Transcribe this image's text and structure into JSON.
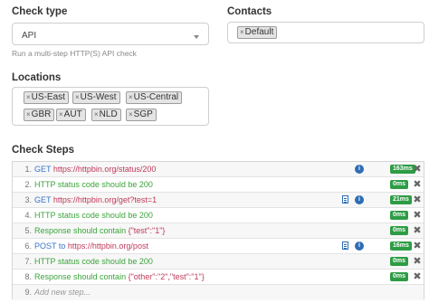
{
  "check_type": {
    "label": "Check type",
    "value": "API",
    "help": "Run a multi-step HTTP(S) API check"
  },
  "contacts": {
    "label": "Contacts",
    "tags": [
      {
        "remove": "×",
        "label": "Default"
      }
    ]
  },
  "locations": {
    "label": "Locations",
    "tags": [
      {
        "remove": "×",
        "label": "US-East"
      },
      {
        "remove": "×",
        "label": "US-West"
      },
      {
        "remove": "×",
        "label": "US-Central"
      },
      {
        "remove": "×",
        "label": "GBR"
      },
      {
        "remove": "×",
        "label": "AUT"
      },
      {
        "remove": "×",
        "label": "NLD"
      },
      {
        "remove": "×",
        "label": "SGP"
      }
    ]
  },
  "check_steps": {
    "label": "Check Steps",
    "steps": [
      {
        "num": "1.",
        "method": "GET",
        "url": "https://httpbin.org/status/200",
        "timing": "163ms",
        "delete": "✖"
      },
      {
        "num": "2.",
        "text": "HTTP status code should be 200",
        "timing": "0ms",
        "delete": "✖"
      },
      {
        "num": "3.",
        "method": "GET",
        "url": "https://httpbin.org/get?test=1",
        "timing": "21ms",
        "delete": "✖"
      },
      {
        "num": "4.",
        "text": "HTTP status code should be 200",
        "timing": "0ms",
        "delete": "✖"
      },
      {
        "num": "5.",
        "text": "Response should contain",
        "query": "{\"test\":\"1\"}",
        "timing": "0ms",
        "delete": "✖"
      },
      {
        "num": "6.",
        "method": "POST",
        "conn": "to",
        "url": "https://httpbin.org/post",
        "timing": "16ms",
        "delete": "✖"
      },
      {
        "num": "7.",
        "text": "HTTP status code should be 200",
        "timing": "0ms",
        "delete": "✖"
      },
      {
        "num": "8.",
        "text": "Response should contain",
        "query": "{\"other\":\"2\",\"test\":\"1\"}",
        "timing": "0ms",
        "delete": "✖"
      },
      {
        "num": "9.",
        "placeholder": "Add new step..."
      }
    ]
  },
  "icons": {
    "info": "i"
  },
  "colors": {
    "method": "#3a74c9",
    "url": "#c0395a",
    "assertion": "#3aa43a",
    "badge": "#2e9c45",
    "info": "#2d6db5"
  }
}
